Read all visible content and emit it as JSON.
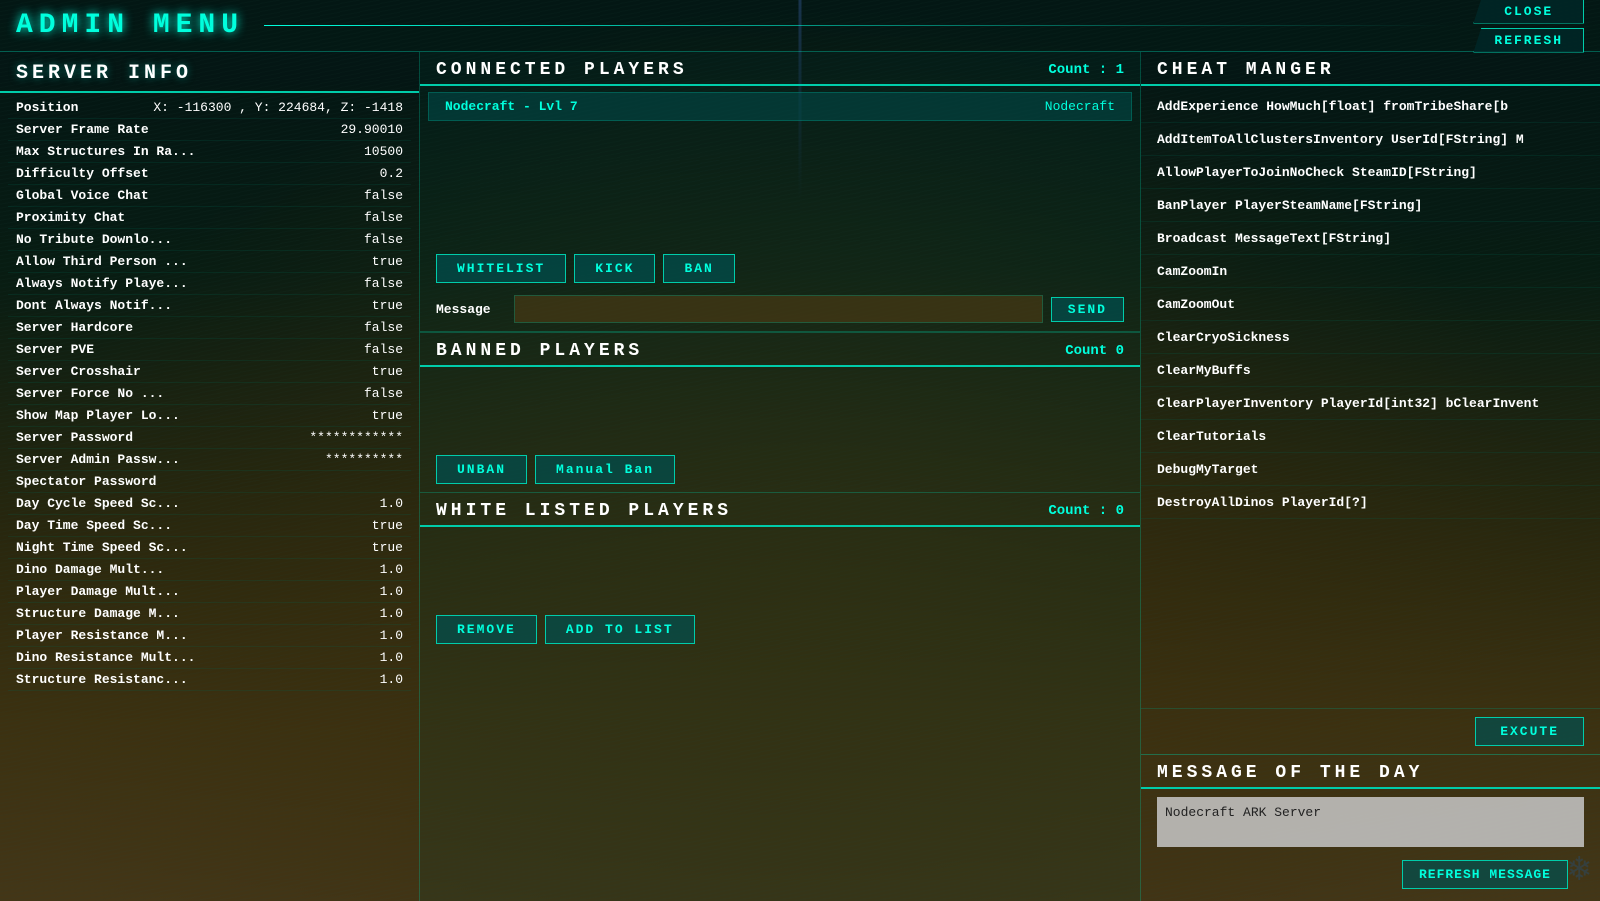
{
  "app": {
    "title": "ADMIN  MENU",
    "close_label": "CLOSE",
    "refresh_label": "REFRESH"
  },
  "server_info": {
    "title": "SERVER  INFO",
    "rows": [
      {
        "label": "Position",
        "value": "X: -116300 , Y: 224684, Z: -1418"
      },
      {
        "label": "Server Frame Rate",
        "value": "29.90010"
      },
      {
        "label": "Max Structures In Ra...",
        "value": "10500"
      },
      {
        "label": "Difficulty Offset",
        "value": "0.2"
      },
      {
        "label": "Global Voice Chat",
        "value": "false"
      },
      {
        "label": "Proximity Chat",
        "value": "false"
      },
      {
        "label": "No Tribute Downlo...",
        "value": "false"
      },
      {
        "label": "Allow Third Person ...",
        "value": "true"
      },
      {
        "label": "Always Notify Playe...",
        "value": "false"
      },
      {
        "label": "Dont Always Notif...",
        "value": "true"
      },
      {
        "label": "Server Hardcore",
        "value": "false"
      },
      {
        "label": "Server PVE",
        "value": "false"
      },
      {
        "label": "Server Crosshair",
        "value": "true"
      },
      {
        "label": "Server Force No ...",
        "value": "false"
      },
      {
        "label": "Show Map Player Lo...",
        "value": "true"
      },
      {
        "label": "Server Password",
        "value": "************"
      },
      {
        "label": "Server Admin Passw...",
        "value": "**********"
      },
      {
        "label": "Spectator Password",
        "value": ""
      },
      {
        "label": "Day Cycle Speed Sc...",
        "value": "1.0"
      },
      {
        "label": "Day Time Speed Sc...",
        "value": "true"
      },
      {
        "label": "Night Time Speed Sc...",
        "value": "true"
      },
      {
        "label": "Dino Damage Mult...",
        "value": "1.0"
      },
      {
        "label": "Player Damage Mult...",
        "value": "1.0"
      },
      {
        "label": "Structure Damage M...",
        "value": "1.0"
      },
      {
        "label": "Player Resistance M...",
        "value": "1.0"
      },
      {
        "label": "Dino Resistance Mult...",
        "value": "1.0"
      },
      {
        "label": "Structure Resistanc...",
        "value": "1.0"
      }
    ]
  },
  "connected_players": {
    "title": "CONNECTED  PLAYERS",
    "count_label": "Count : 1",
    "players": [
      {
        "name": "Nodecraft - Lvl 7",
        "extra": "Nodecraft"
      }
    ],
    "whitelist_btn": "WHITELIST",
    "kick_btn": "KICK",
    "ban_btn": "BAN",
    "message_label": "Message",
    "send_btn": "SEND"
  },
  "banned_players": {
    "title": "BANNED  PLAYERS",
    "count_label": "Count  0",
    "unban_btn": "UNBAN",
    "manual_ban_btn": "Manual Ban"
  },
  "whitelisted_players": {
    "title": "WHITE  LISTED  PLAYERS",
    "count_label": "Count : 0",
    "remove_btn": "REMOVE",
    "add_btn": "ADD TO LIST"
  },
  "cheat_manager": {
    "title": "CHEAT  MANGER",
    "cheats": [
      "AddExperience HowMuch[float] fromTribeShare[b",
      "AddItemToAllClustersInventory UserId[FString] M",
      "AllowPlayerToJoinNoCheck SteamID[FString]",
      "BanPlayer PlayerSteamName[FString]",
      "Broadcast MessageText[FString]",
      "CamZoomIn",
      "CamZoomOut",
      "ClearCryoSickness",
      "ClearMyBuffs",
      "ClearPlayerInventory PlayerId[int32] bClearInvent",
      "ClearTutorials",
      "DebugMyTarget",
      "DestroyAllDinos PlayerId[?]"
    ],
    "excute_btn": "EXCUTE"
  },
  "motd": {
    "title": "MESSAGE  OF  THE  DAY",
    "value": "Nodecraft ARK Server",
    "refresh_btn": "REFRESH MESSAGE"
  }
}
